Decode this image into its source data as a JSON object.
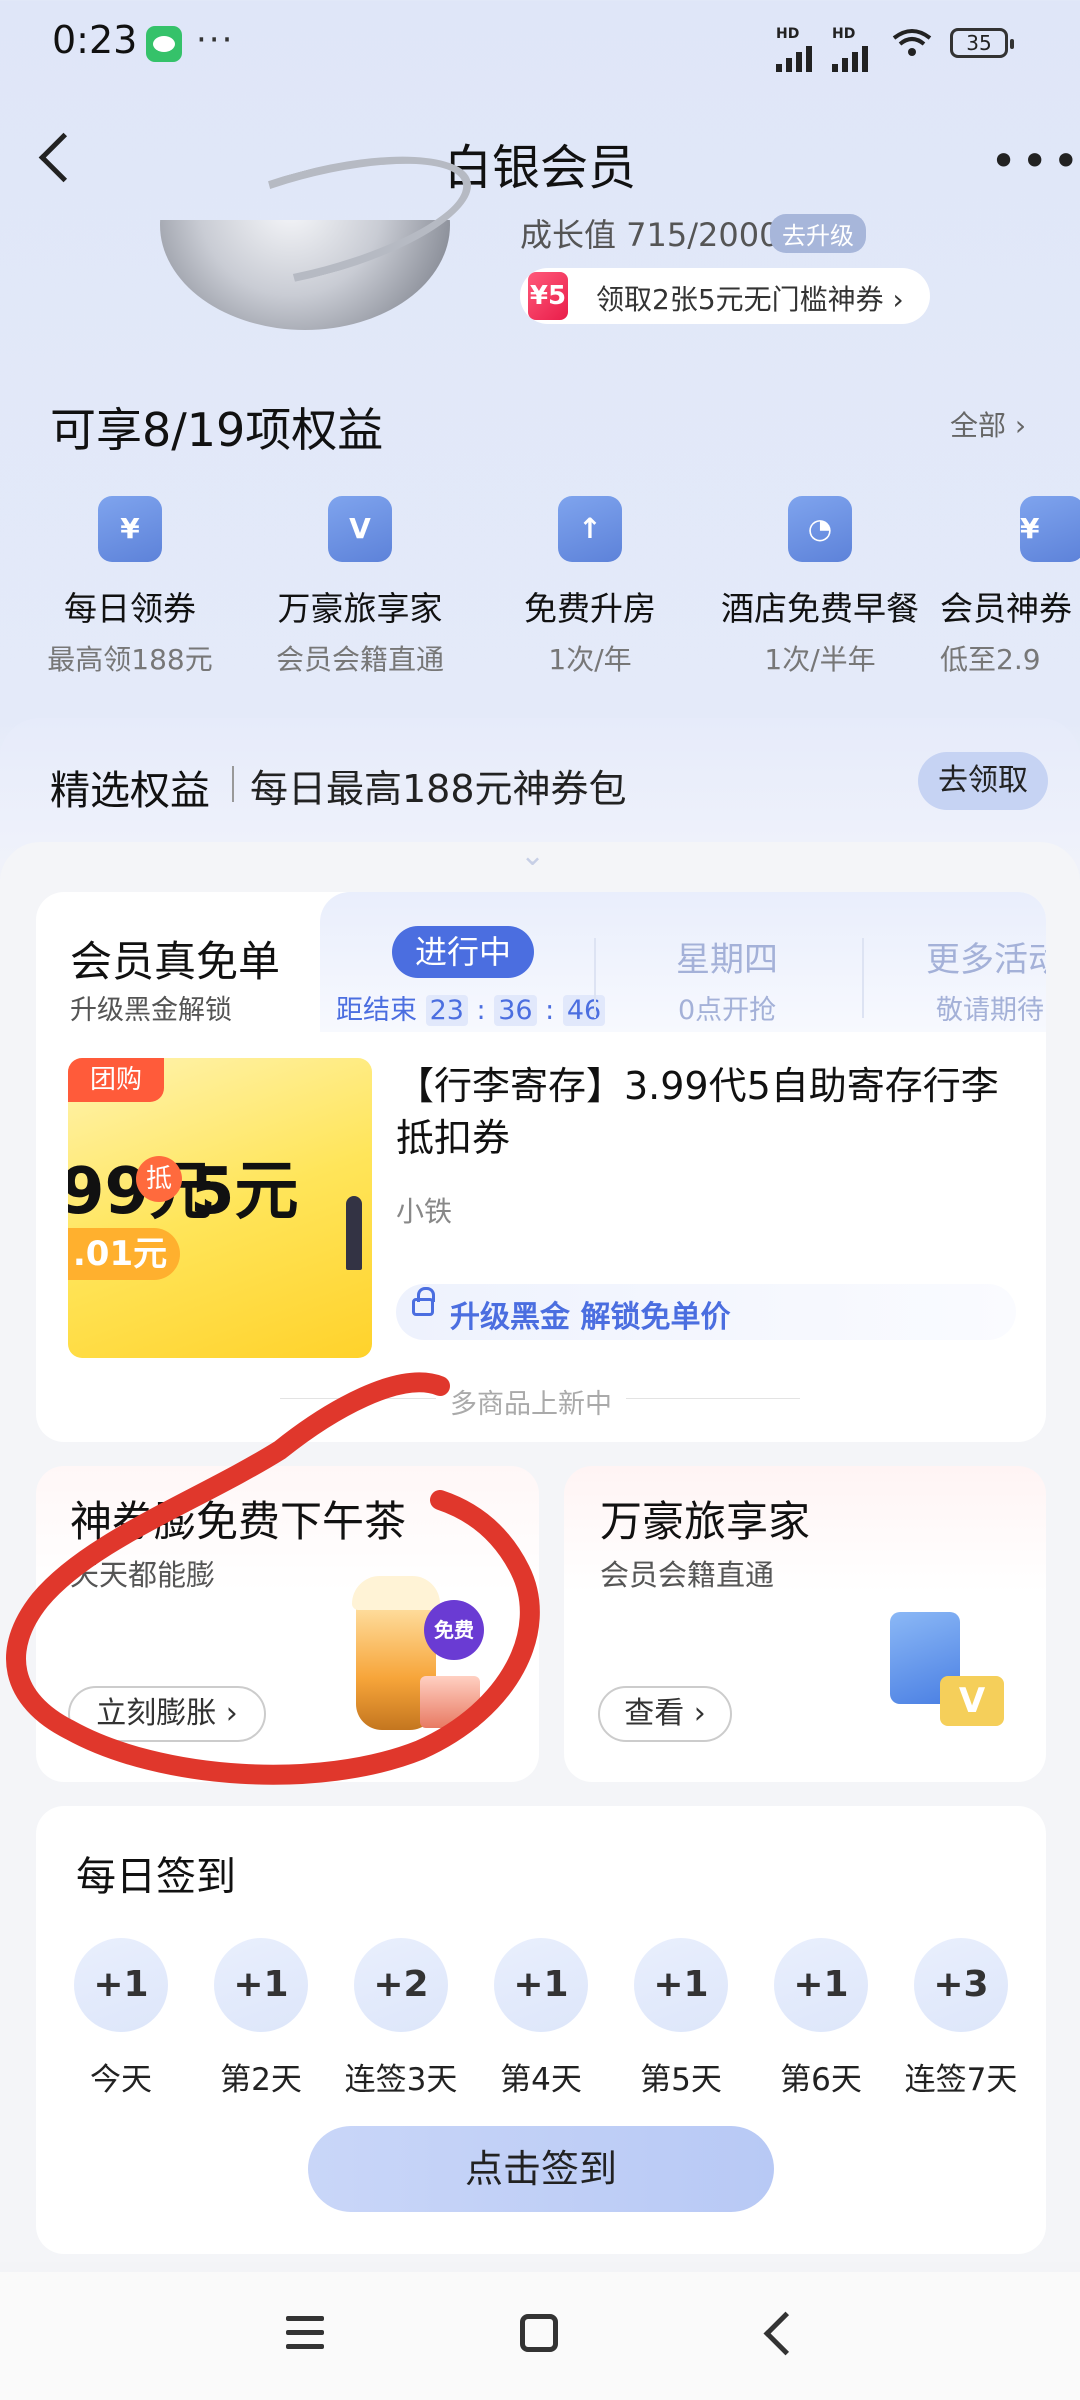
{
  "status_bar": {
    "time": "0:23",
    "battery": "35",
    "signal_label": "HD"
  },
  "header": {
    "title": "白银会员"
  },
  "membership": {
    "growth": "成长值 715/2000",
    "upgrade_label": "去升级",
    "coupon_icon_text": "¥5",
    "coupon_text": "领取2张5元无门槛神券 ›"
  },
  "benefits": {
    "title": "可享8/19项权益",
    "all_label": "全部 ›",
    "items": [
      {
        "icon_text": "¥",
        "name": "每日领券",
        "sub": "最高领188元"
      },
      {
        "icon_text": "V",
        "name": "万豪旅享家",
        "sub": "会员会籍直通"
      },
      {
        "icon_text": "↑",
        "name": "免费升房",
        "sub": "1次/年"
      },
      {
        "icon_text": "◔",
        "name": "酒店免费早餐",
        "sub": "1次/半年"
      },
      {
        "icon_text": "¥",
        "name": "会员神券",
        "sub": "低至2.9"
      }
    ]
  },
  "selected": {
    "title": "精选权益",
    "subtitle": "每日最高188元神券包",
    "claim_label": "去领取"
  },
  "free_order": {
    "title": "会员真免单",
    "sub": "升级黑金解锁",
    "tab_active": "进行中",
    "countdown_prefix": "距结束",
    "countdown_h": "23",
    "countdown_m": "36",
    "countdown_s": "46",
    "tab2": "星期四",
    "tab2_sub": "0点开抢",
    "tab3": "更多活动",
    "tab3_sub": "敬请期待",
    "product": {
      "tag": "团购",
      "price_a": "99元",
      "di": "抵",
      "price_b": "5元",
      "price_c": ".01元",
      "name": "【行李寄存】3.99代5自助寄存行李抵扣券",
      "seller": "小铁",
      "unlock_label": "升级黑金 解锁免单价"
    },
    "footer_note": "多商品上新中"
  },
  "promo_cards": [
    {
      "title": "神券膨免费下午茶",
      "sub": "天天都能膨",
      "button": "立刻膨胀 ›",
      "badge": "免费"
    },
    {
      "title": "万豪旅享家",
      "sub": "会员会籍直通",
      "button": "查看 ›",
      "icon_text": "V"
    }
  ],
  "checkin": {
    "title": "每日签到",
    "days": [
      {
        "points": "+1",
        "label": "今天"
      },
      {
        "points": "+1",
        "label": "第2天"
      },
      {
        "points": "+2",
        "label": "连签3天"
      },
      {
        "points": "+1",
        "label": "第4天"
      },
      {
        "points": "+1",
        "label": "第5天"
      },
      {
        "points": "+1",
        "label": "第6天"
      },
      {
        "points": "+3",
        "label": "连签7天"
      }
    ],
    "button": "点击签到"
  },
  "colors": {
    "accent": "#4b6ee0",
    "annotation": "#e0372c"
  }
}
